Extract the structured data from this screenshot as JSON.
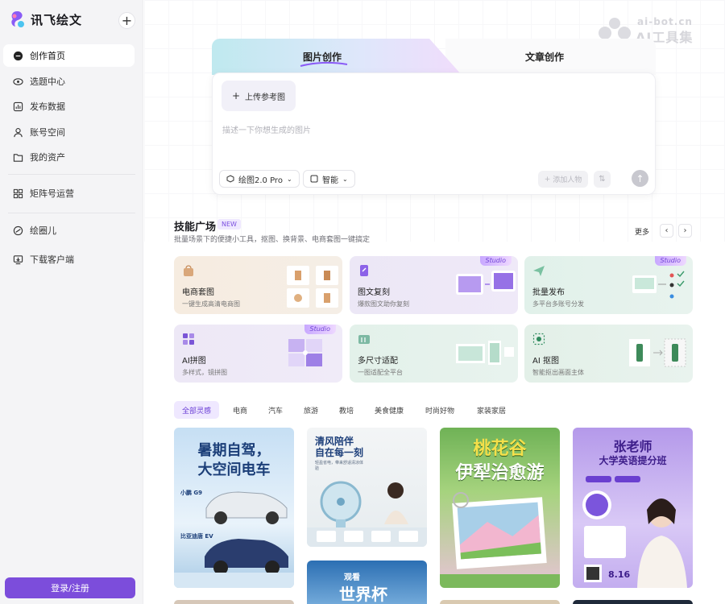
{
  "app": {
    "name": "讯飞绘文"
  },
  "sidebar": {
    "items": [
      {
        "label": "创作首页",
        "icon": "chat-bubble-icon"
      },
      {
        "label": "选题中心",
        "icon": "eye-icon"
      },
      {
        "label": "发布数据",
        "icon": "chart-icon"
      },
      {
        "label": "账号空间",
        "icon": "user-icon"
      },
      {
        "label": "我的资产",
        "icon": "folder-icon"
      },
      {
        "label": "矩阵号运营",
        "icon": "grid-icon"
      },
      {
        "label": "绘圈儿",
        "icon": "circle-icon"
      },
      {
        "label": "下载客户端",
        "icon": "download-icon"
      }
    ],
    "login_label": "登录/注册"
  },
  "watermark": {
    "small": "ai-bot.cn",
    "big": "AI工具集"
  },
  "composer": {
    "tabs": [
      "图片创作",
      "文章创作"
    ],
    "upload_label": "上传参考图",
    "placeholder": "描述一下你想生成的图片",
    "model_chip": "绘图2.0 Pro",
    "mode_chip": "智能",
    "add_person": "添加人物"
  },
  "skills": {
    "title": "技能广场",
    "badge": "NEW",
    "subtitle": "批量场景下的便捷小工具，抠图、换背景、电商套图一键搞定",
    "more": "更多",
    "items": [
      {
        "name": "电商套图",
        "desc": "一键生成高清电商图",
        "studio": ""
      },
      {
        "name": "图文复刻",
        "desc": "爆款图文助你复刻",
        "studio": "Studio"
      },
      {
        "name": "批量发布",
        "desc": "多平台多账号分发",
        "studio": "Studio"
      },
      {
        "name": "AI拼图",
        "desc": "多样式，镜拼图",
        "studio": "Studio"
      },
      {
        "name": "多尺寸适配",
        "desc": "一图适配全平台",
        "studio": ""
      },
      {
        "name": "AI 抠图",
        "desc": "智能抠出画面主体",
        "studio": ""
      }
    ]
  },
  "filters": [
    "全部灵感",
    "电商",
    "汽车",
    "旅游",
    "教培",
    "美食健康",
    "时尚好物",
    "家装家居"
  ],
  "posters": [
    {
      "title": "暑期自驾，",
      "title2": "大空间电车",
      "tag1": "小鹏 G9",
      "tag2": "比亚迪唐 EV"
    },
    {
      "title": "清风陪伴",
      "title2": "自在每一刻",
      "sub": "轻盈省电，带来舒适清凉体验"
    },
    {
      "title": "桃花谷",
      "title2": "伊犁治愈游"
    },
    {
      "title": "张老师",
      "title2": "大学英语提分班",
      "date": "8.16"
    },
    {
      "title": "世界杯",
      "title2": "观看"
    }
  ],
  "colors": {
    "accent": "#7c4ddb",
    "badge_bg": "#efe8ff"
  }
}
